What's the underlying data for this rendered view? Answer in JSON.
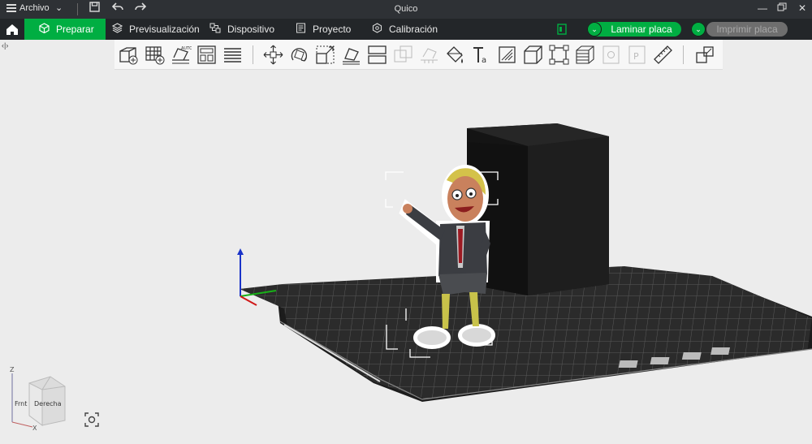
{
  "titlebar": {
    "menu_label": "Archivo",
    "title": "Quico"
  },
  "tabs": [
    {
      "label": "Preparar",
      "icon": "cube-outline-icon",
      "active": true
    },
    {
      "label": "Previsualización",
      "icon": "layers-icon",
      "active": false
    },
    {
      "label": "Dispositivo",
      "icon": "device-icon",
      "active": false
    },
    {
      "label": "Proyecto",
      "icon": "document-icon",
      "active": false
    },
    {
      "label": "Calibración",
      "icon": "calibration-icon",
      "active": false
    }
  ],
  "actions": {
    "slice_label": "Laminar placa",
    "print_label": "Imprimir placa"
  },
  "toolbar_icons": [
    "add-object-icon",
    "add-plate-icon",
    "auto-orient-icon",
    "arrange-icon",
    "split-layers-icon",
    "move-icon",
    "rotate-icon",
    "scale-icon",
    "place-on-face-icon",
    "cut-icon",
    "boolean-icon",
    "support-paint-icon",
    "seam-paint-icon",
    "text-icon",
    "emboss-icon",
    "measure-box-icon",
    "assembly-icon",
    "variable-layer-icon",
    "modifier-icon",
    "part-icon",
    "ruler-icon",
    "explode-icon"
  ],
  "axis_cube": {
    "front_label": "Frnt",
    "right_label": "Derecha",
    "z_label": "Z",
    "x_label": "X"
  },
  "colors": {
    "accent": "#00ae42",
    "titlebar": "#2e3135",
    "tabbar": "#232629",
    "viewport_bg": "#ececec"
  }
}
